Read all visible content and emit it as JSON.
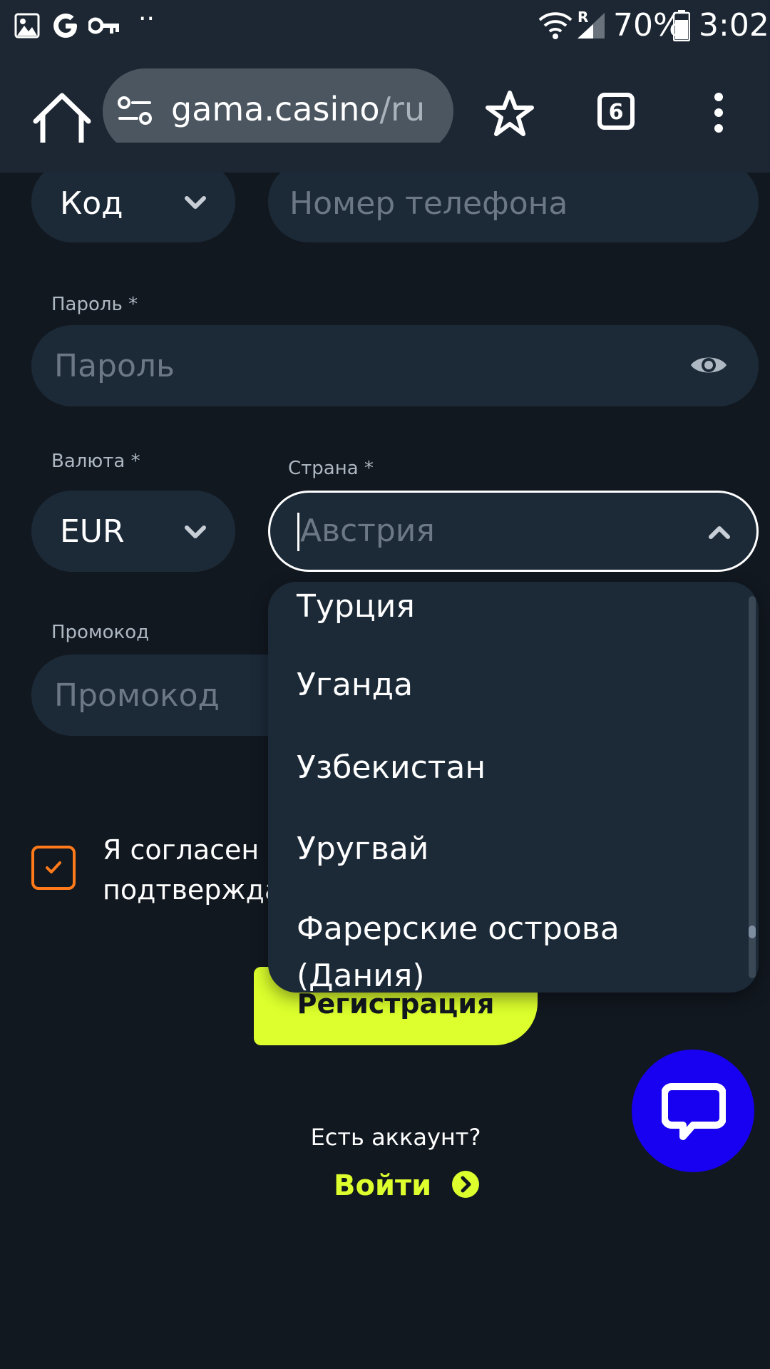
{
  "statusbar": {
    "battery_percent": "70%",
    "time": "3:02",
    "dots": "··",
    "roaming_indicator": "R",
    "icons": [
      "gallery-icon",
      "google-icon",
      "key-icon",
      "wifi-icon",
      "signal-icon",
      "battery-icon"
    ]
  },
  "browser": {
    "url_domain": "gama.casino",
    "url_path": "/ru",
    "tab_count": "6",
    "icons": [
      "home-icon",
      "site-settings-icon",
      "star-icon",
      "tabs-icon",
      "menu-icon"
    ]
  },
  "form": {
    "phone": {
      "code_value": "Код",
      "number_placeholder": "Номер телефона"
    },
    "password": {
      "label": "Пароль *",
      "placeholder": "Пароль"
    },
    "currency": {
      "label": "Валюта *",
      "value": "EUR"
    },
    "country": {
      "label": "Страна *",
      "placeholder": "Австрия",
      "options": [
        "Турция",
        "Уганда",
        "Узбекистан",
        "Уругвай",
        "Фарерские острова",
        "(Дания)"
      ]
    },
    "promo": {
      "label": "Промокод",
      "placeholder": "Промокод"
    },
    "agree": {
      "line1": "Я согласен с",
      "line2": "подтвержда"
    },
    "register_label": "Регистрация",
    "have_account": "Есть аккаунт?",
    "login_label": "Войти"
  },
  "colors": {
    "background": "#121820",
    "field": "#1c2a38",
    "accent": "#dcff2d",
    "checkbox": "#ff7a1a",
    "chat": "#1800f0"
  }
}
